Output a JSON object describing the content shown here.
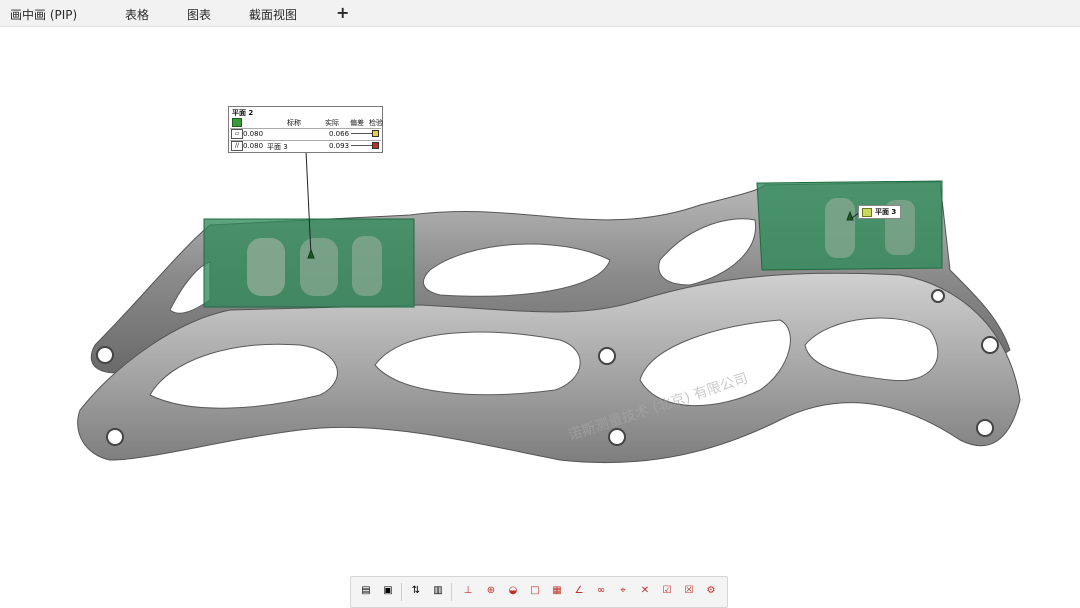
{
  "tabs": [
    {
      "label": "画中画 (PIP)"
    },
    {
      "label": "表格"
    },
    {
      "label": "图表"
    },
    {
      "label": "截面视图"
    }
  ],
  "tab_add_label": "+",
  "annotation": {
    "title": "平面 2",
    "headers": [
      "标称",
      "实际",
      "偏差",
      "检验"
    ],
    "rows": [
      {
        "symbol": "flatness-icon",
        "symbol_text": "▱",
        "tolerance": "0.080",
        "datum": "",
        "actual": "0.066",
        "status_color": "#e6d23a"
      },
      {
        "symbol": "parallelism-icon",
        "symbol_text": "//",
        "tolerance": "0.080",
        "datum": "平面 3",
        "actual": "0.093",
        "status_color": "#c0302a"
      }
    ]
  },
  "label3": {
    "text": "平面 3"
  },
  "watermark": "诺斯测量技术 (北京) 有限公司",
  "colors": {
    "part_gray": "#8e8e8e",
    "highlight_green": "#2f8a5a",
    "tab_bg": "#f2f2f2"
  },
  "toolbar_icons": [
    "view-grid-icon",
    "monitor-icon",
    "sort-icon",
    "columns-icon",
    "datum-icon",
    "position-icon",
    "profile-icon",
    "square-icon",
    "report-icon",
    "angle-icon",
    "link-icon",
    "target-icon",
    "cross-icon",
    "check-icon",
    "close-icon",
    "gear-icon"
  ]
}
